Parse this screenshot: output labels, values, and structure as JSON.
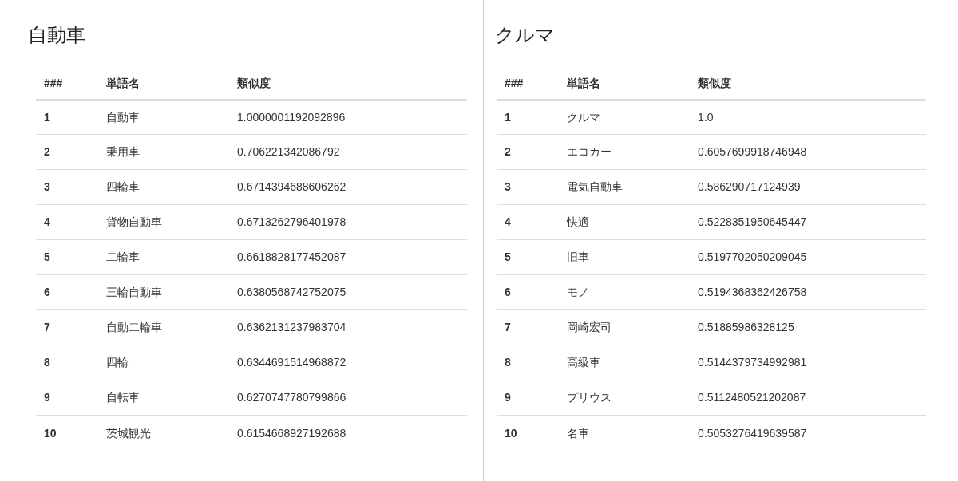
{
  "panels": [
    {
      "title": "自動車",
      "columns": [
        "###",
        "単語名",
        "類似度"
      ],
      "rows": [
        [
          "1",
          "自動車",
          "1.0000001192092896"
        ],
        [
          "2",
          "乗用車",
          "0.706221342086792"
        ],
        [
          "3",
          "四輪車",
          "0.6714394688606262"
        ],
        [
          "4",
          "貨物自動車",
          "0.6713262796401978"
        ],
        [
          "5",
          "二輪車",
          "0.6618828177452087"
        ],
        [
          "6",
          "三輪自動車",
          "0.6380568742752075"
        ],
        [
          "7",
          "自動二輪車",
          "0.6362131237983704"
        ],
        [
          "8",
          "四輪",
          "0.6344691514968872"
        ],
        [
          "9",
          "自転車",
          "0.6270747780799866"
        ],
        [
          "10",
          "茨城観光",
          "0.6154668927192688"
        ]
      ]
    },
    {
      "title": "クルマ",
      "columns": [
        "###",
        "単語名",
        "類似度"
      ],
      "rows": [
        [
          "1",
          "クルマ",
          "1.0"
        ],
        [
          "2",
          "エコカー",
          "0.6057699918746948"
        ],
        [
          "3",
          "電気自動車",
          "0.586290717124939"
        ],
        [
          "4",
          "快適",
          "0.5228351950645447"
        ],
        [
          "5",
          "旧車",
          "0.5197702050209045"
        ],
        [
          "6",
          "モノ",
          "0.5194368362426758"
        ],
        [
          "7",
          "岡崎宏司",
          "0.51885986328125"
        ],
        [
          "8",
          "高級車",
          "0.5144379734992981"
        ],
        [
          "9",
          "プリウス",
          "0.5112480521202087"
        ],
        [
          "10",
          "名車",
          "0.5053276419639587"
        ]
      ]
    }
  ]
}
